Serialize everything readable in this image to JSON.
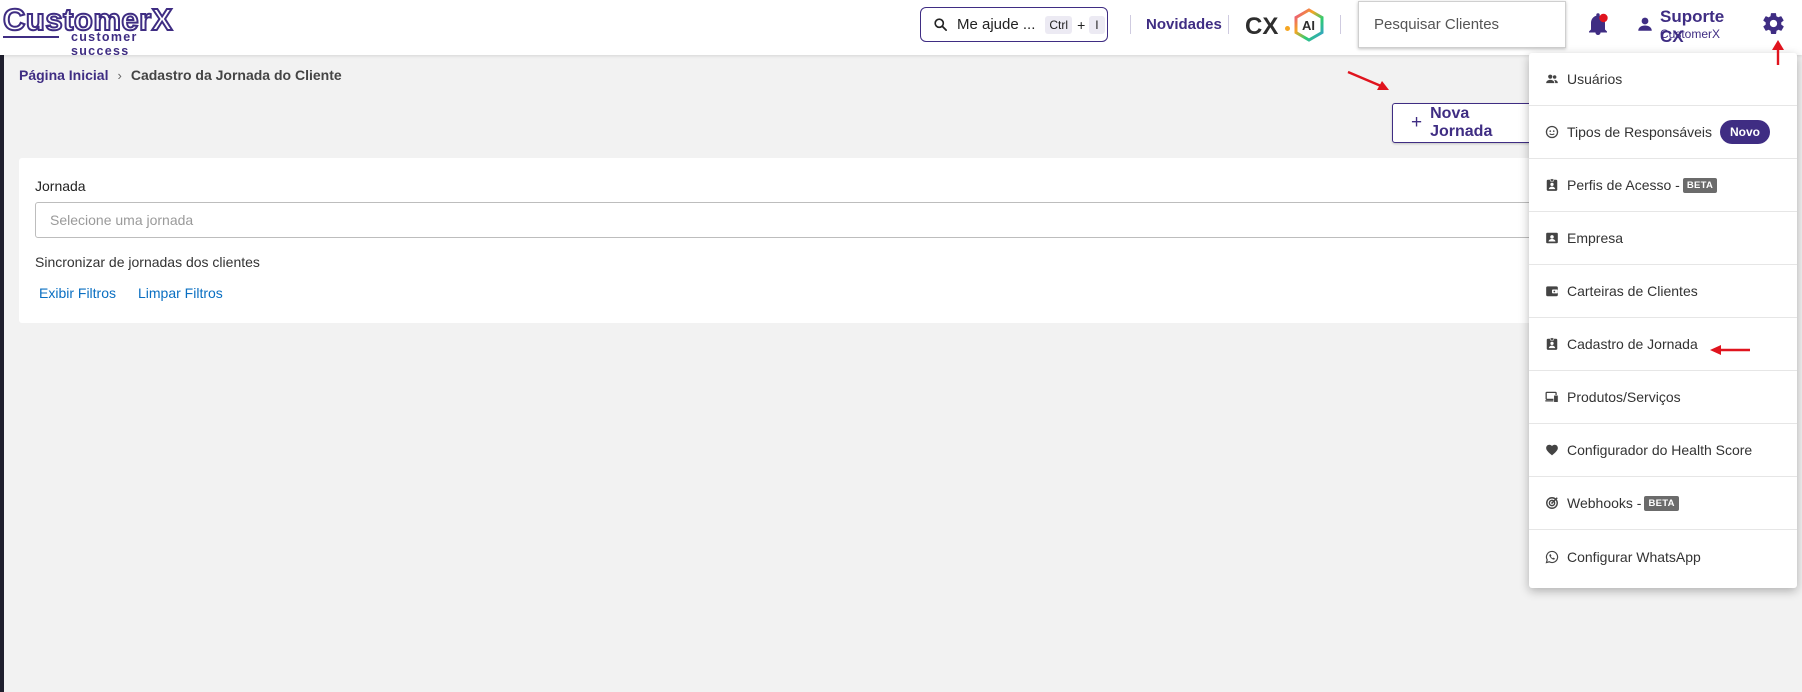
{
  "header": {
    "logo": {
      "main": "CustomerX",
      "sub": "customer success"
    },
    "help": {
      "label": "Me ajude ...",
      "key1": "Ctrl",
      "plus": "+",
      "key2": "I"
    },
    "novidades": "Novidades",
    "cx_ai": {
      "cx": "CX",
      "ai": "AI"
    },
    "search_clientes_placeholder": "Pesquisar Clientes",
    "user": {
      "name": "Suporte CX",
      "company": "CustomerX"
    }
  },
  "breadcrumb": {
    "home": "Página Inicial",
    "separator": "›",
    "current": "Cadastro da Jornada do Cliente"
  },
  "actions": {
    "nova_jornada": "Nova Jornada",
    "nova_jornada_icon": "+"
  },
  "filters": {
    "jornada_label": "Jornada",
    "jornada_placeholder": "Selecione uma jornada",
    "sync_text": "Sincronizar de jornadas dos clientes",
    "exibir_filtros": "Exibir Filtros",
    "limpar_filtros": "Limpar Filtros"
  },
  "settings_menu": {
    "items": [
      {
        "label": "Usuários",
        "icon": "users-icon"
      },
      {
        "label": "Tipos de Responsáveis",
        "icon": "face-icon",
        "badge": "Novo"
      },
      {
        "label": "Perfis de Acesso -",
        "icon": "badge-icon",
        "badge": "BETA"
      },
      {
        "label": "Empresa",
        "icon": "id-card-icon"
      },
      {
        "label": "Carteiras de Clientes",
        "icon": "wallet-icon"
      },
      {
        "label": "Cadastro de Jornada",
        "icon": "badge-icon"
      },
      {
        "label": "Produtos/Serviços",
        "icon": "devices-icon"
      },
      {
        "label": "Configurador do Health Score",
        "icon": "heart-icon"
      },
      {
        "label": "Webhooks -",
        "icon": "webhook-icon",
        "badge": "BETA"
      },
      {
        "label": "Configurar WhatsApp",
        "icon": "whatsapp-icon"
      }
    ]
  },
  "colors": {
    "brand": "#3f2d83",
    "link": "#0a6fc2",
    "annotation": "#e0141e",
    "notification": "#e0141e"
  }
}
